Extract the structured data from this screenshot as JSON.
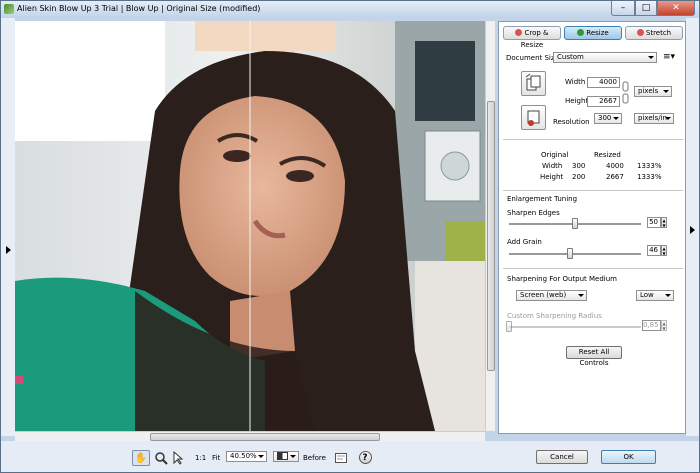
{
  "window": {
    "title": "Alien Skin Blow Up 3 Trial | Blow Up | Original Size (modified)",
    "minimize": "–",
    "maximize": "□",
    "close": "✕"
  },
  "tabs": [
    {
      "label": "Crop & Resize",
      "color": "#d9534f"
    },
    {
      "label": "Resize",
      "color": "#2e9a2e",
      "active": true
    },
    {
      "label": "Stretch",
      "color": "#d9534f"
    }
  ],
  "resize": {
    "document_size_label": "Document Size",
    "document_size_value": "Custom",
    "width_label": "Width",
    "width_value": "4000",
    "height_label": "Height",
    "height_value": "2667",
    "unit_value": "pixels",
    "resolution_label": "Resolution",
    "resolution_value": "300",
    "resolution_unit": "pixels/in"
  },
  "size_table": {
    "headers": [
      "Original",
      "Resized"
    ],
    "rows": [
      {
        "label": "Width",
        "original": "300",
        "resized": "4000",
        "percent": "1333%"
      },
      {
        "label": "Height",
        "original": "200",
        "resized": "2667",
        "percent": "1333%"
      }
    ]
  },
  "enlargement": {
    "section_label": "Enlargement Tuning",
    "sharpen_label": "Sharpen Edges",
    "sharpen_value": "50",
    "sharpen_level": 0.5,
    "grain_label": "Add Grain",
    "grain_value": "46",
    "grain_level": 0.46
  },
  "sharpening": {
    "section_label": "Sharpening For Output Medium",
    "medium_value": "Screen (web)",
    "amount_value": "Low",
    "radius_label": "Custom Sharpening Radius",
    "radius_value": "0,85",
    "radius_level": 0.0
  },
  "reset_label": "Reset All Controls",
  "toolbar": {
    "ratio_label": "1:1",
    "fit_label": "Fit",
    "zoom_value": "40.50%",
    "before_label": "Before",
    "help_glyph": "?"
  },
  "footer": {
    "cancel_label": "Cancel",
    "ok_label": "OK"
  }
}
